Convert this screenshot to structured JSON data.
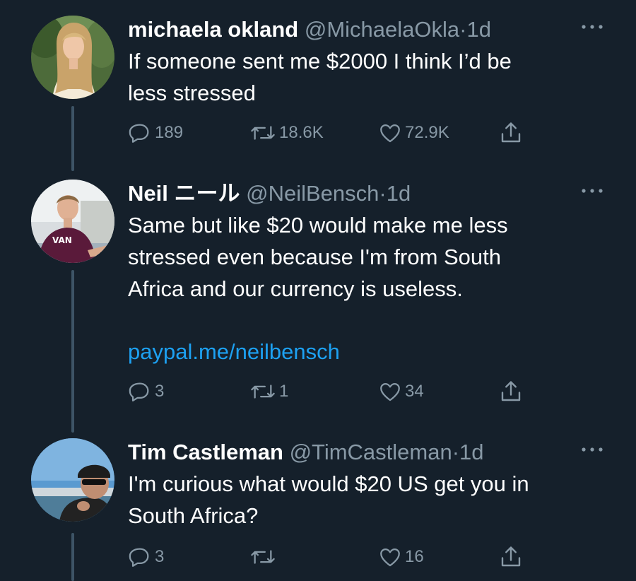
{
  "tweets": [
    {
      "name": "michaela okland",
      "handle": "@MichaelaOkla",
      "separator": "·",
      "time": "1d",
      "lines": [
        "If someone sent me $2000 I think I’d be",
        "less stressed"
      ],
      "link": "",
      "replies": "189",
      "retweets": "18.6K",
      "likes": "72.9K",
      "avatar": "avatar-michaela"
    },
    {
      "name": "Neil ニール",
      "handle": "@NeilBensch",
      "separator": "·",
      "time": "1d",
      "lines": [
        "Same but like $20 would make me less",
        "stressed even because I'm from South",
        "Africa and our currency is useless."
      ],
      "link": "paypal.me/neilbensch",
      "replies": "3",
      "retweets": "1",
      "likes": "34",
      "avatar": "avatar-neil"
    },
    {
      "name": "Tim Castleman",
      "handle": "@TimCastleman",
      "separator": "·",
      "time": "1d",
      "lines": [
        "I'm curious what would $20 US get you in",
        "South Africa?"
      ],
      "link": "",
      "replies": "3",
      "retweets": "",
      "likes": "16",
      "avatar": "avatar-tim"
    }
  ],
  "icons": {
    "reply": "reply-icon",
    "retweet": "retweet-icon",
    "like": "like-icon",
    "share": "share-icon",
    "more": "more-icon"
  },
  "colors": {
    "background": "#15202b",
    "text": "#ffffff",
    "secondary": "#8899a6",
    "link": "#1da1f2",
    "thread_line": "#3d5466"
  }
}
